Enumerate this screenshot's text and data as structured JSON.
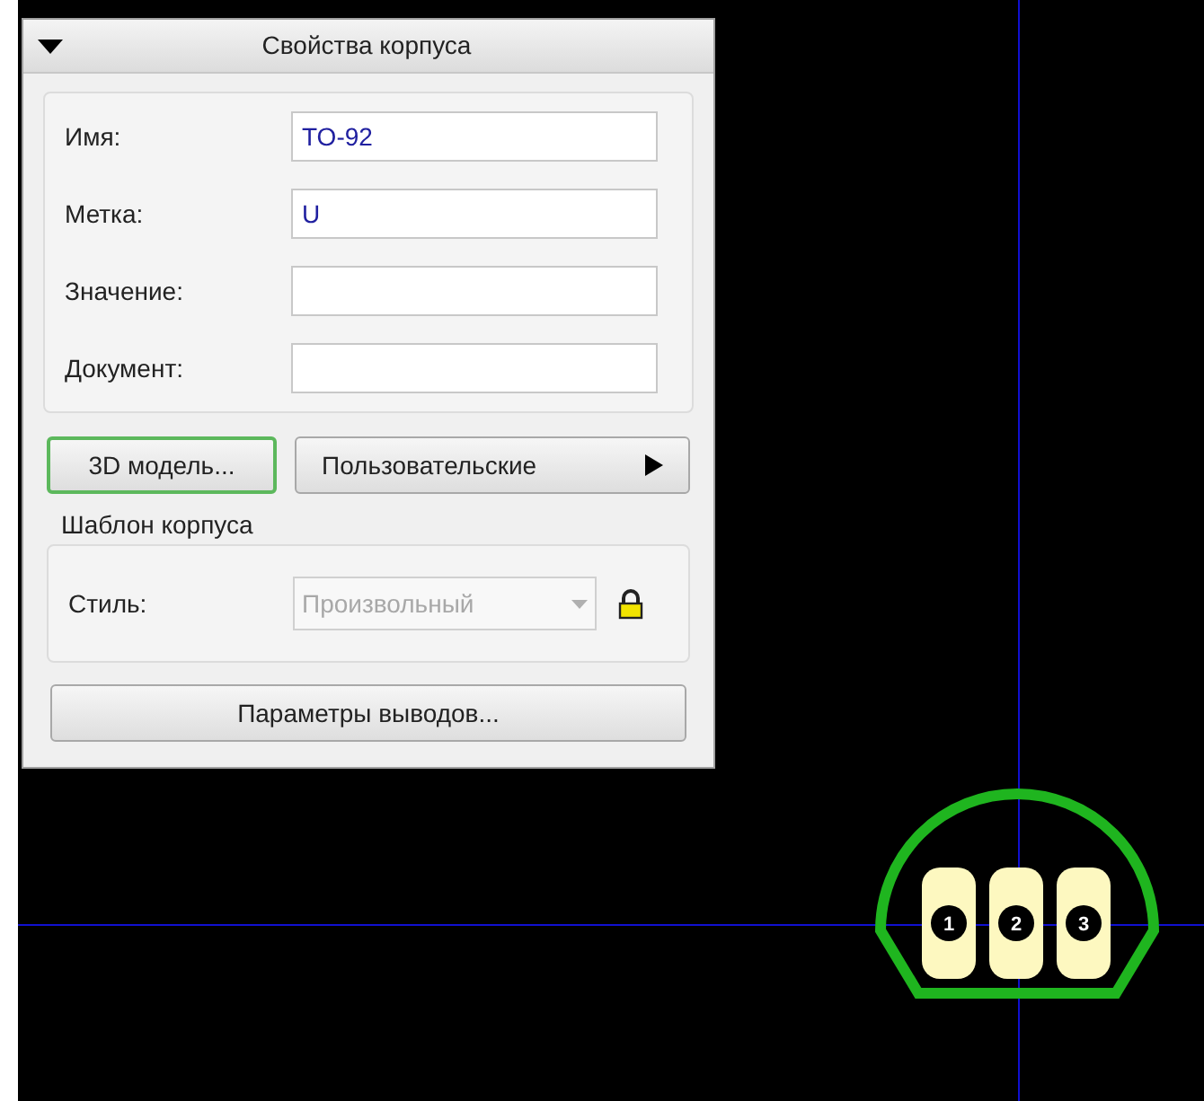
{
  "panel": {
    "title": "Свойства корпуса",
    "expanded": true,
    "fields": [
      {
        "label": "Имя:",
        "value": "TO-92"
      },
      {
        "label": "Метка:",
        "value": "U"
      },
      {
        "label": "Значение:"
      },
      {
        "label": "Документ:"
      }
    ],
    "buttons": [
      {
        "label": "3D модель...",
        "focused": true,
        "submenu": false
      },
      {
        "label": "Пользовательские",
        "focused": false,
        "submenu": true
      }
    ],
    "template": {
      "title": "Шаблон корпуса",
      "style_label": "Стиль:",
      "style_value": "Произвольный",
      "disabled": true,
      "locked": true
    },
    "pin_button": "Параметры выводов..."
  },
  "canvas": {
    "pads": [
      {
        "number": "1"
      },
      {
        "number": "2"
      },
      {
        "number": "3"
      }
    ]
  }
}
